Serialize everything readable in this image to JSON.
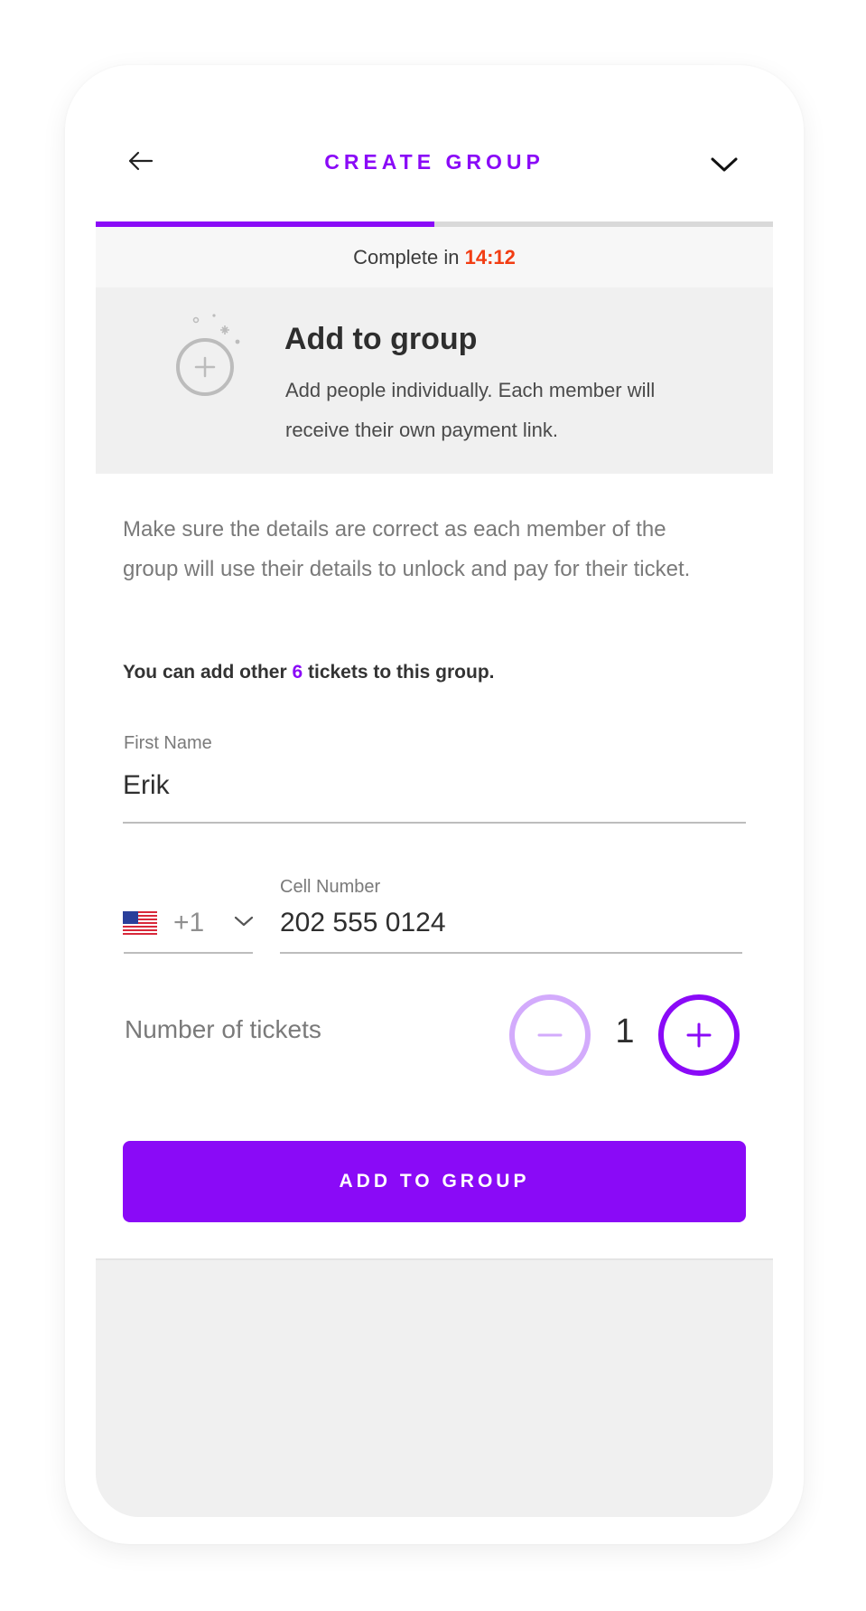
{
  "header": {
    "title": "CREATE GROUP",
    "back_icon": "arrow-left-icon",
    "menu_icon": "chevron-down-icon"
  },
  "progress": {
    "fraction": 0.5
  },
  "timer": {
    "prefix": "Complete in ",
    "value": "14:12"
  },
  "info": {
    "icon": "add-circle-icon",
    "title": "Add to group",
    "description": "Add people individually. Each member will receive their own payment link."
  },
  "lead_text": "Make sure the details are correct as each member of the group will use their details to unlock and pay for their ticket.",
  "ticket_note": {
    "before": "You can add other ",
    "count": "6",
    "after": " tickets to this group."
  },
  "first_name": {
    "label": "First Name",
    "value": "Erik"
  },
  "phone": {
    "country_flag_icon": "us-flag-icon",
    "country_code": "+1",
    "label": "Cell Number",
    "value": "202 555 0124"
  },
  "tickets": {
    "label": "Number of tickets",
    "quantity": "1"
  },
  "cta_label": "ADD TO GROUP",
  "colors": {
    "accent": "#8a0af7",
    "accent_light": "#d3abfc",
    "timer_red": "#f23d13",
    "panel_gray": "#f0f0f0"
  }
}
